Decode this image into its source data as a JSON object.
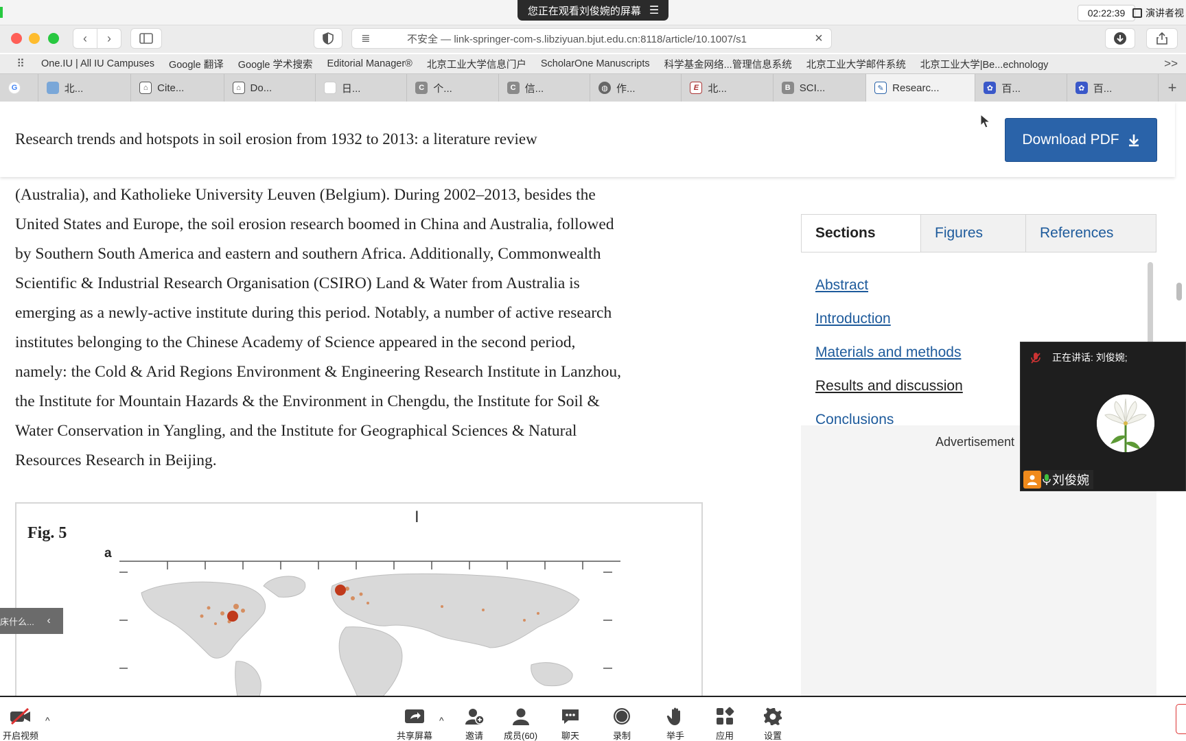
{
  "meeting": {
    "share_banner": "您正在观看刘俊婉的屏幕",
    "clock": "02:22:39",
    "presenter_view": "演讲者视"
  },
  "browser": {
    "url": "不安全 — link-springer-com-s.libziyuan.bjut.edu.cn:8118/article/10.1007/s1",
    "bookmarks": [
      "One.IU | All IU Campuses",
      "Google 翻译",
      "Google 学术搜索",
      "Editorial Manager®",
      "北京工业大学信息门户",
      "ScholarOne Manuscripts",
      "科学基金网络...管理信息系统",
      "北京工业大学邮件系统",
      "北京工业大学|Be...echnology"
    ],
    "bookmarks_more": ">>",
    "tabs": [
      {
        "label": "",
        "icon": "google-icon"
      },
      {
        "label": "北...",
        "icon": "image-icon"
      },
      {
        "label": "Cite...",
        "icon": "building-icon"
      },
      {
        "label": "Do...",
        "icon": "building-icon"
      },
      {
        "label": "日...",
        "icon": "blank-icon"
      },
      {
        "label": "个...",
        "icon": "c-icon"
      },
      {
        "label": "信...",
        "icon": "c-icon"
      },
      {
        "label": "作...",
        "icon": "globe-icon"
      },
      {
        "label": "北...",
        "icon": "e-icon"
      },
      {
        "label": "SCI...",
        "icon": "b-icon"
      },
      {
        "label": "Researc...",
        "icon": "springer-icon"
      },
      {
        "label": "百...",
        "icon": "baidu-icon"
      },
      {
        "label": "百...",
        "icon": "baidu-icon"
      }
    ]
  },
  "article": {
    "title": "Research trends and hotspots in soil erosion from 1932 to 2013: a literature review",
    "download_label": "Download PDF",
    "body_lines": [
      "(Australia), and Katholieke University Leuven (Belgium). During 2002–2013, besides the",
      "United States and Europe, the soil erosion research boomed in China and Australia, followed",
      "by Southern South America and eastern and southern Africa. Additionally, Commonwealth",
      "Scientific & Industrial Research Organisation (CSIRO) Land & Water from Australia is",
      "emerging as a newly-active institute during this period. Notably, a number of active research",
      "institutes belonging to the Chinese Academy of Science appeared in the second period,",
      "namely: the Cold & Arid Regions Environment & Engineering Research Institute in Lanzhou,",
      "the Institute for Mountain Hazards & the Environment in Chengdu, the Institute for Soil &",
      "Water Conservation in Yangling, and the Institute for Geographical Sciences & Natural",
      "Resources Research in Beijing."
    ],
    "figure_label": "Fig. 5",
    "figure_sub": "a"
  },
  "sidebar": {
    "tabs": {
      "sections": "Sections",
      "figures": "Figures",
      "references": "References"
    },
    "sections": [
      "Abstract",
      "Introduction",
      "Materials and methods",
      "Results and discussion",
      "Conclusions"
    ],
    "current_section": "Results and discussion",
    "advertisement": "Advertisement"
  },
  "video": {
    "speaking": "正在讲话: 刘俊婉;",
    "name": "刘俊婉"
  },
  "side_widget": {
    "text": "床什么..."
  },
  "zoom_toolbar": {
    "start_video": "开启视频",
    "share_screen": "共享屏幕",
    "invite": "邀请",
    "participants": "成员(60)",
    "chat": "聊天",
    "record": "录制",
    "raise_hand": "举手",
    "apps": "应用",
    "settings": "设置"
  },
  "colors": {
    "link": "#1d5a9b",
    "download_button": "#2a63a9",
    "video_panel": "#1e1e1e"
  }
}
